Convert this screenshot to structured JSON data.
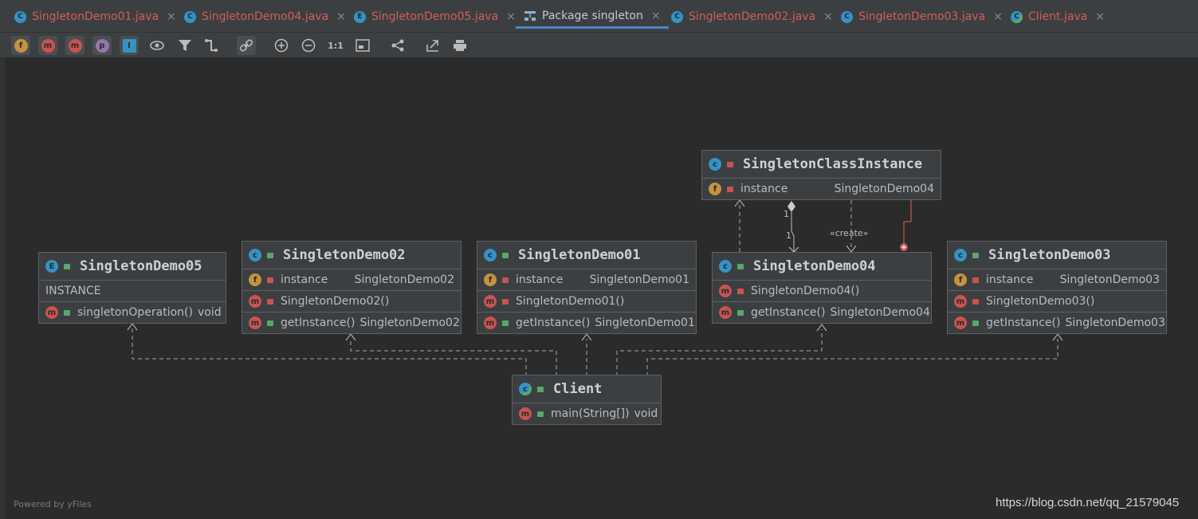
{
  "tabs": [
    {
      "label": "SingletonDemo01.java",
      "icon": "class-icon",
      "color": "#d35c5c"
    },
    {
      "label": "SingletonDemo04.java",
      "icon": "class-icon",
      "color": "#d35c5c"
    },
    {
      "label": "SingletonDemo05.java",
      "icon": "enum-icon",
      "color": "#d35c5c"
    },
    {
      "label": "Package singleton",
      "icon": "diagram-icon",
      "color": "#c8c8c8",
      "active": true
    },
    {
      "label": "SingletonDemo02.java",
      "icon": "class-icon",
      "color": "#d35c5c"
    },
    {
      "label": "SingletonDemo03.java",
      "icon": "class-icon",
      "color": "#d35c5c"
    },
    {
      "label": "Client.java",
      "icon": "runnable-class-icon",
      "color": "#d35c5c"
    }
  ],
  "toolbar": {
    "fields": "f",
    "constructors": "m",
    "methods": "m",
    "properties": "p",
    "inner_classes": "I",
    "zoom_actual": "1:1"
  },
  "diagram": {
    "singleton_class_instance": {
      "name": "SingletonClassInstance",
      "field_name": "instance",
      "field_type": "SingletonDemo04"
    },
    "demo05": {
      "name": "SingletonDemo05",
      "constant": "INSTANCE",
      "method": "singletonOperation()",
      "method_type": "void"
    },
    "demo02": {
      "name": "SingletonDemo02",
      "field_name": "instance",
      "field_type": "SingletonDemo02",
      "ctor": "SingletonDemo02()",
      "method": "getInstance()",
      "method_type": "SingletonDemo02"
    },
    "demo01": {
      "name": "SingletonDemo01",
      "field_name": "instance",
      "field_type": "SingletonDemo01",
      "ctor": "SingletonDemo01()",
      "method": "getInstance()",
      "method_type": "SingletonDemo01"
    },
    "demo04": {
      "name": "SingletonDemo04",
      "ctor": "SingletonDemo04()",
      "method": "getInstance()",
      "method_type": "SingletonDemo04"
    },
    "demo03": {
      "name": "SingletonDemo03",
      "field_name": "instance",
      "field_type": "SingletonDemo03",
      "ctor": "SingletonDemo03()",
      "method": "getInstance()",
      "method_type": "SingletonDemo03"
    },
    "client": {
      "name": "Client",
      "method": "main(String[])",
      "method_type": "void"
    },
    "labels": {
      "mult_top": "1",
      "mult_bottom": "1",
      "create": "«create»"
    }
  },
  "footer": {
    "powered": "Powered by yFiles",
    "watermark": "https://blog.csdn.net/qq_21579045"
  },
  "colors": {
    "accent": "#4a88c7",
    "class_icon": "#3592c4",
    "field_icon": "#c5923e",
    "method_icon": "#c75450",
    "inner_link": "#c75450"
  }
}
